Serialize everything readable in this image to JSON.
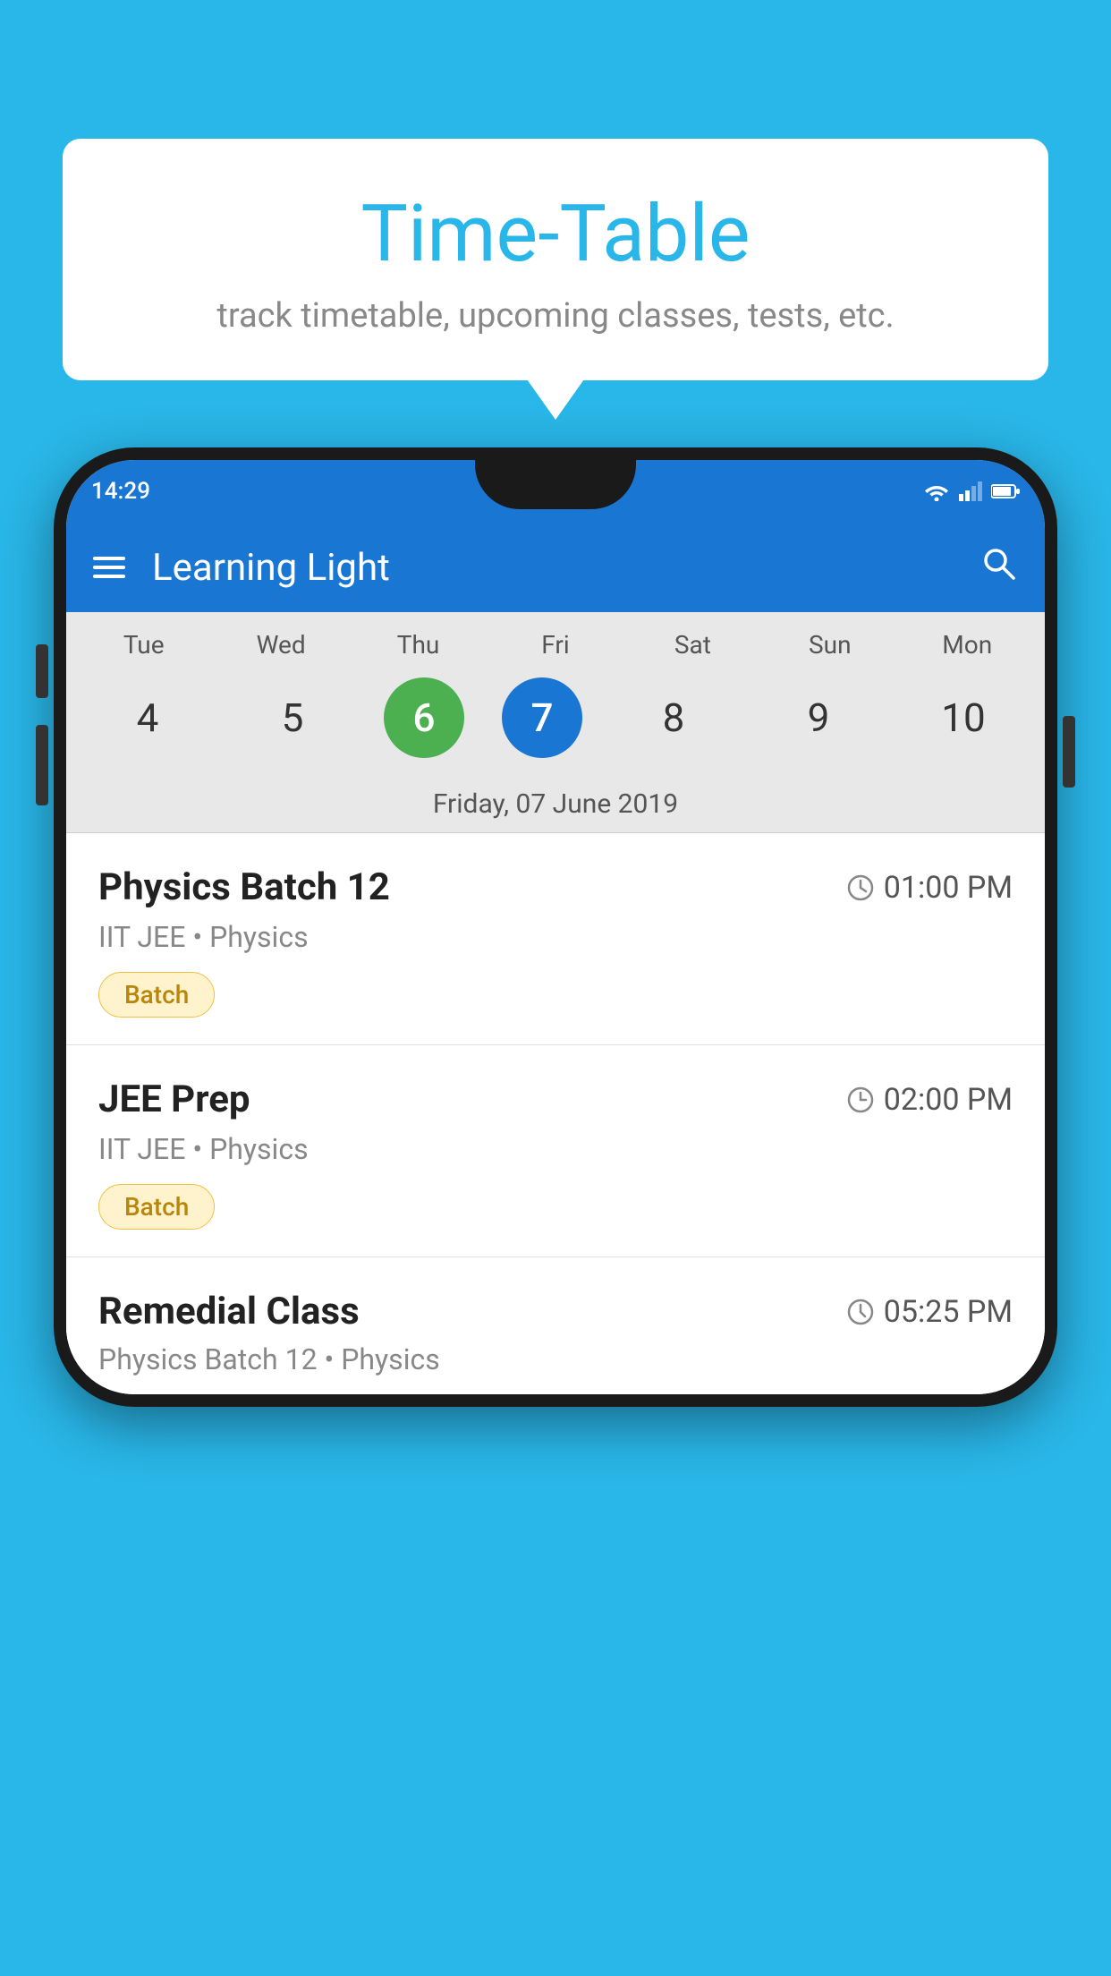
{
  "background": {
    "color": "#29B6E8"
  },
  "tooltip": {
    "title": "Time-Table",
    "subtitle": "track timetable, upcoming classes, tests, etc."
  },
  "phone": {
    "status_bar": {
      "time": "14:29"
    },
    "app_bar": {
      "title": "Learning Light"
    },
    "calendar": {
      "days": [
        "Tue",
        "Wed",
        "Thu",
        "Fri",
        "Sat",
        "Sun",
        "Mon"
      ],
      "dates": [
        "4",
        "5",
        "6",
        "7",
        "8",
        "9",
        "10"
      ],
      "today_index": 2,
      "selected_index": 3,
      "selected_label": "Friday, 07 June 2019"
    },
    "schedule": [
      {
        "name": "Physics Batch 12",
        "time": "01:00 PM",
        "sub": "IIT JEE • Physics",
        "badge": "Batch"
      },
      {
        "name": "JEE Prep",
        "time": "02:00 PM",
        "sub": "IIT JEE • Physics",
        "badge": "Batch"
      },
      {
        "name": "Remedial Class",
        "time": "05:25 PM",
        "sub": "Physics Batch 12 • Physics",
        "badge": null
      }
    ]
  }
}
